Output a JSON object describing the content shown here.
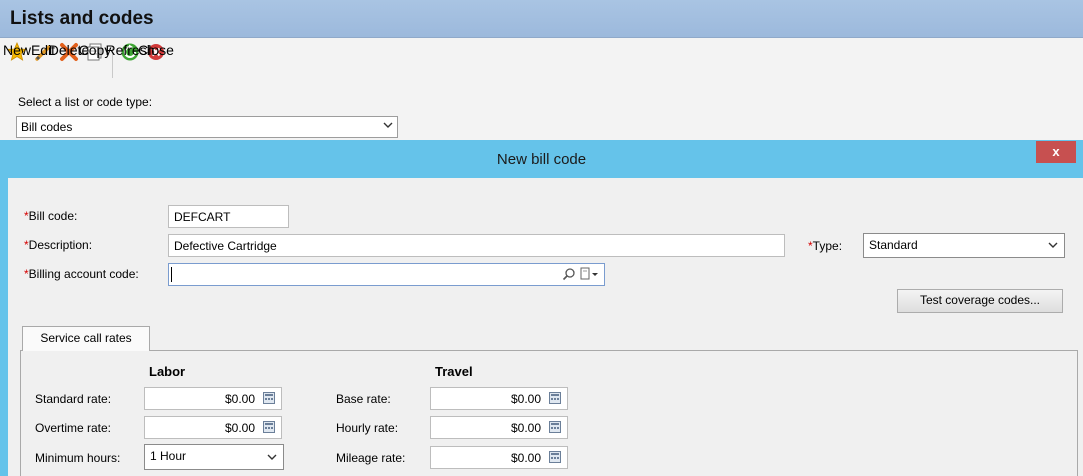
{
  "window": {
    "title": "Lists and codes"
  },
  "toolbar": {
    "new": "New",
    "edit": "Edit",
    "delete": "Delete",
    "copy": "Copy",
    "refresh": "Refresh",
    "close": "Close"
  },
  "list_selector": {
    "label": "Select a list or code type:",
    "value": "Bill codes"
  },
  "dialog": {
    "title": "New bill code",
    "close_glyph": "x",
    "required_mark": "*",
    "bill_code": {
      "label": "Bill code:",
      "value": "DEFCART"
    },
    "description": {
      "label": "Description:",
      "value": "Defective Cartridge"
    },
    "type": {
      "label": "Type:",
      "value": "Standard"
    },
    "billing_account_code": {
      "label": "Billing account code:",
      "value": ""
    },
    "test_coverage_button": "Test coverage codes...",
    "tab": "Service call rates",
    "labor": {
      "heading": "Labor",
      "standard_rate": {
        "label": "Standard rate:",
        "value": "$0.00"
      },
      "overtime_rate": {
        "label": "Overtime rate:",
        "value": "$0.00"
      },
      "minimum_hours": {
        "label": "Minimum hours:",
        "value": "1 Hour"
      }
    },
    "travel": {
      "heading": "Travel",
      "base_rate": {
        "label": "Base rate:",
        "value": "$0.00"
      },
      "hourly_rate": {
        "label": "Hourly rate:",
        "value": "$0.00"
      },
      "mileage_rate": {
        "label": "Mileage rate:",
        "value": "$0.00"
      }
    }
  },
  "colors": {
    "dialog_frame": "#65c3ea",
    "header": "#9cb9dc",
    "close": "#c75050",
    "required": "#d40000"
  }
}
